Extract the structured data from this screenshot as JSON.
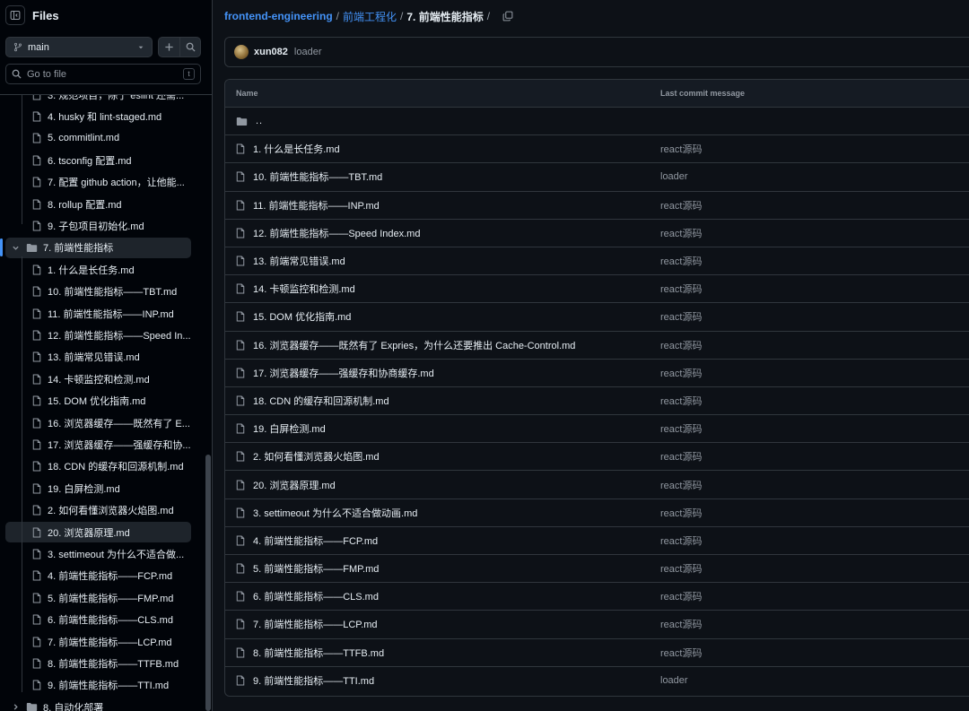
{
  "sidebar": {
    "title": "Files",
    "branch": "main",
    "search_placeholder": "Go to file",
    "search_shortcut": "t",
    "tree": [
      {
        "type": "file",
        "label": "3. 规范项目，除了 eslint 还需...",
        "partial": true
      },
      {
        "type": "file",
        "label": "4. husky 和 lint-staged.md"
      },
      {
        "type": "file",
        "label": "5. commitlint.md"
      },
      {
        "type": "file",
        "label": "6. tsconfig 配置.md"
      },
      {
        "type": "file",
        "label": "7. 配置 github action，让他能..."
      },
      {
        "type": "file",
        "label": "8. rollup 配置.md"
      },
      {
        "type": "file",
        "label": "9. 子包项目初始化.md"
      },
      {
        "type": "dir",
        "label": "7. 前端性能指标",
        "expanded": true,
        "selected": true
      },
      {
        "type": "file",
        "label": "1. 什么是长任务.md"
      },
      {
        "type": "file",
        "label": "10. 前端性能指标——TBT.md"
      },
      {
        "type": "file",
        "label": "11. 前端性能指标——INP.md"
      },
      {
        "type": "file",
        "label": "12. 前端性能指标——Speed In..."
      },
      {
        "type": "file",
        "label": "13. 前端常见错误.md"
      },
      {
        "type": "file",
        "label": "14. 卡顿监控和检测.md"
      },
      {
        "type": "file",
        "label": "15. DOM 优化指南.md"
      },
      {
        "type": "file",
        "label": "16. 浏览器缓存——既然有了 E..."
      },
      {
        "type": "file",
        "label": "17. 浏览器缓存——强缓存和协..."
      },
      {
        "type": "file",
        "label": "18. CDN 的缓存和回源机制.md"
      },
      {
        "type": "file",
        "label": "19. 白屏检测.md"
      },
      {
        "type": "file",
        "label": "2. 如何看懂浏览器火焰图.md"
      },
      {
        "type": "file",
        "label": "20. 浏览器原理.md",
        "hovered": true
      },
      {
        "type": "file",
        "label": "3. settimeout 为什么不适合做..."
      },
      {
        "type": "file",
        "label": "4. 前端性能指标——FCP.md"
      },
      {
        "type": "file",
        "label": "5. 前端性能指标——FMP.md"
      },
      {
        "type": "file",
        "label": "6. 前端性能指标——CLS.md"
      },
      {
        "type": "file",
        "label": "7. 前端性能指标——LCP.md"
      },
      {
        "type": "file",
        "label": "8. 前端性能指标——TTFB.md"
      },
      {
        "type": "file",
        "label": "9. 前端性能指标——TTI.md"
      },
      {
        "type": "dir",
        "label": "8. 自动化部署",
        "expanded": false
      }
    ]
  },
  "breadcrumb": {
    "repo": "frontend-engineering",
    "folder": "前端工程化",
    "current": "7. 前端性能指标"
  },
  "commit": {
    "author": "xun082",
    "message": "loader"
  },
  "table": {
    "col_name": "Name",
    "col_commit": "Last commit message",
    "parent": "..",
    "rows": [
      {
        "name": "1. 什么是长任务.md",
        "commit": "react源码"
      },
      {
        "name": "10. 前端性能指标——TBT.md",
        "commit": "loader"
      },
      {
        "name": "11. 前端性能指标——INP.md",
        "commit": "react源码"
      },
      {
        "name": "12. 前端性能指标——Speed Index.md",
        "commit": "react源码"
      },
      {
        "name": "13. 前端常见错误.md",
        "commit": "react源码"
      },
      {
        "name": "14. 卡顿监控和检测.md",
        "commit": "react源码"
      },
      {
        "name": "15. DOM 优化指南.md",
        "commit": "react源码"
      },
      {
        "name": "16. 浏览器缓存——既然有了 Expries，为什么还要推出 Cache-Control.md",
        "commit": "react源码"
      },
      {
        "name": "17. 浏览器缓存——强缓存和协商缓存.md",
        "commit": "react源码"
      },
      {
        "name": "18. CDN 的缓存和回源机制.md",
        "commit": "react源码"
      },
      {
        "name": "19. 白屏检测.md",
        "commit": "react源码"
      },
      {
        "name": "2. 如何看懂浏览器火焰图.md",
        "commit": "react源码"
      },
      {
        "name": "20. 浏览器原理.md",
        "commit": "react源码"
      },
      {
        "name": "3. settimeout 为什么不适合做动画.md",
        "commit": "react源码"
      },
      {
        "name": "4. 前端性能指标——FCP.md",
        "commit": "react源码"
      },
      {
        "name": "5. 前端性能指标——FMP.md",
        "commit": "react源码"
      },
      {
        "name": "6. 前端性能指标——CLS.md",
        "commit": "react源码"
      },
      {
        "name": "7. 前端性能指标——LCP.md",
        "commit": "react源码"
      },
      {
        "name": "8. 前端性能指标——TTFB.md",
        "commit": "react源码"
      },
      {
        "name": "9. 前端性能指标——TTI.md",
        "commit": "loader"
      }
    ]
  },
  "colors": {
    "accent": "#4493f8",
    "background": "#0d1117",
    "sidebar": "#010409",
    "border": "#30363d",
    "muted": "#9198a1"
  }
}
